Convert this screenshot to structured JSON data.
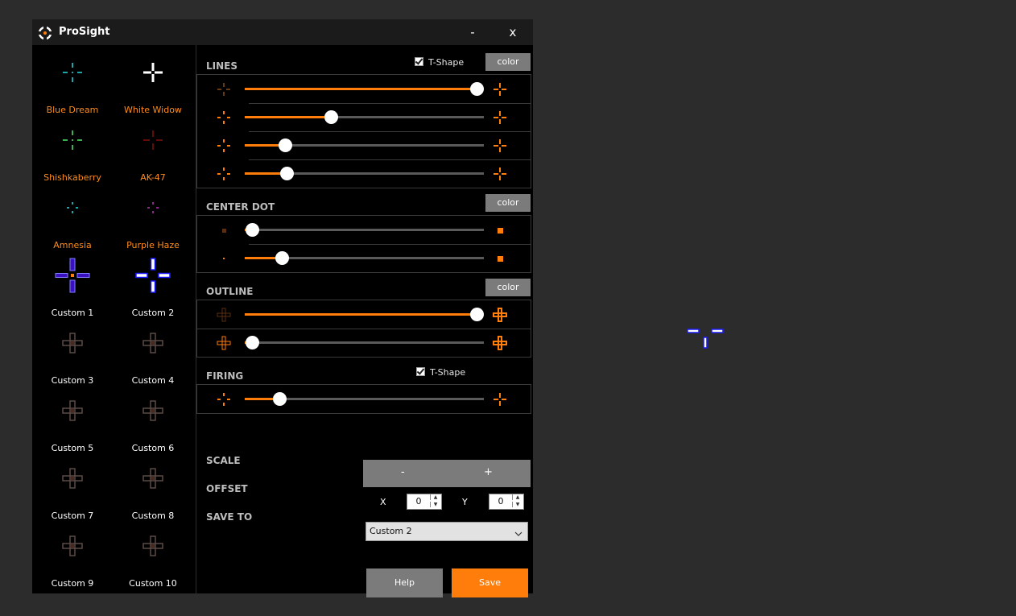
{
  "window": {
    "title": "ProSight",
    "minimize_label": "-",
    "close_label": "x"
  },
  "colors": {
    "accent": "#ff7d0a",
    "panel_button": "#7b7b7b",
    "background": "#2c2c2c"
  },
  "presets": [
    {
      "label": "Blue Dream",
      "color": "#1fa4a8",
      "label_color": "#ff8c1a"
    },
    {
      "label": "White Widow",
      "color": "#ffffff",
      "label_color": "#ff8c1a"
    },
    {
      "label": "Shishkaberry",
      "color": "#3cb050",
      "label_color": "#ff8c1a"
    },
    {
      "label": "AK-47",
      "color": "#c01a10",
      "label_color": "#ff8c1a"
    },
    {
      "label": "Amnesia",
      "color": "#1fa4a8",
      "label_color": "#ff8c1a"
    },
    {
      "label": "Purple Haze",
      "color": "#8a2a8a",
      "label_color": "#ff8c1a"
    },
    {
      "label": "Custom 1",
      "color": "#3a10c0",
      "label_color": "#ffffff"
    },
    {
      "label": "Custom 2",
      "color": "#ffffff",
      "label_color": "#ffffff"
    },
    {
      "label": "Custom 3",
      "color": "#5a4a45",
      "label_color": "#ffffff"
    },
    {
      "label": "Custom 4",
      "color": "#5a4a45",
      "label_color": "#ffffff"
    },
    {
      "label": "Custom 5",
      "color": "#5a4a45",
      "label_color": "#ffffff"
    },
    {
      "label": "Custom 6",
      "color": "#5a4a45",
      "label_color": "#ffffff"
    },
    {
      "label": "Custom 7",
      "color": "#5a4a45",
      "label_color": "#ffffff"
    },
    {
      "label": "Custom 8",
      "color": "#5a4a45",
      "label_color": "#ffffff"
    },
    {
      "label": "Custom 9",
      "color": "#5a4a45",
      "label_color": "#ffffff"
    },
    {
      "label": "Custom 10",
      "color": "#5a4a45",
      "label_color": "#ffffff"
    }
  ],
  "lines": {
    "title": "LINES",
    "tshape_label": "T-Shape",
    "tshape_checked": true,
    "color_label": "color",
    "sliders": [
      0.97,
      0.36,
      0.17,
      0.175
    ]
  },
  "center_dot": {
    "title": "CENTER DOT",
    "color_label": "color",
    "sliders": [
      0.03,
      0.155
    ]
  },
  "outline": {
    "title": "OUTLINE",
    "color_label": "color",
    "sliders": [
      0.97,
      0.03
    ]
  },
  "firing": {
    "title": "FIRING",
    "tshape_label": "T-Shape",
    "tshape_checked": true,
    "sliders": [
      0.145
    ]
  },
  "scale": {
    "label": "SCALE",
    "minus_label": "-",
    "plus_label": "+"
  },
  "offset": {
    "label": "OFFSET",
    "x_label": "X",
    "x_value": "0",
    "y_label": "Y",
    "y_value": "0"
  },
  "save_to": {
    "label": "SAVE TO",
    "selected": "Custom 2"
  },
  "buttons": {
    "help_label": "Help",
    "save_label": "Save"
  }
}
